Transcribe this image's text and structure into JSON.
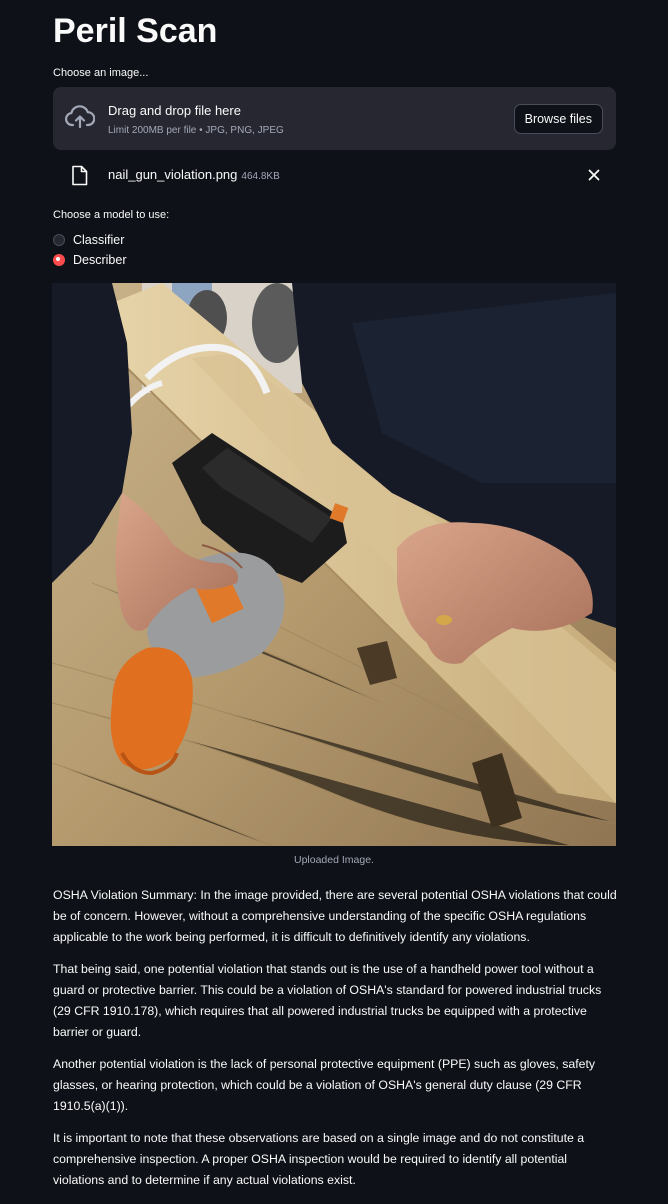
{
  "app": {
    "title": "Peril Scan"
  },
  "uploader": {
    "label": "Choose an image...",
    "drop_title": "Drag and drop file here",
    "drop_limit": "Limit 200MB per file • JPG, PNG, JPEG",
    "browse_label": "Browse files",
    "upload_icon": "cloud-upload-icon",
    "file": {
      "name": "nail_gun_violation.png",
      "size": "464.8KB",
      "file_icon": "file-icon",
      "remove_icon": "close-icon"
    }
  },
  "model_select": {
    "label": "Choose a model to use:",
    "options": [
      {
        "label": "Classifier",
        "selected": false
      },
      {
        "label": "Describer",
        "selected": true
      }
    ]
  },
  "image": {
    "caption": "Uploaded Image."
  },
  "summary": {
    "paragraphs": [
      "OSHA Violation Summary: In the image provided, there are several potential OSHA violations that could be of concern. However, without a comprehensive understanding of the specific OSHA regulations applicable to the work being performed, it is difficult to definitively identify any violations.",
      "That being said, one potential violation that stands out is the use of a handheld power tool without a guard or protective barrier. This could be a violation of OSHA's standard for powered industrial trucks (29 CFR 1910.178), which requires that all powered industrial trucks be equipped with a protective barrier or guard.",
      "Another potential violation is the lack of personal protective equipment (PPE) such as gloves, safety glasses, or hearing protection, which could be a violation of OSHA's general duty clause (29 CFR 1910.5(a)(1)).",
      "It is important to note that these observations are based on a single image and do not constitute a comprehensive inspection. A proper OSHA inspection would be required to identify all potential violations and to determine if any actual violations exist."
    ]
  },
  "colors": {
    "background": "#0e1117",
    "surface": "#262730",
    "accent": "#ff4b4b",
    "muted_text": "#a3a8b8"
  }
}
